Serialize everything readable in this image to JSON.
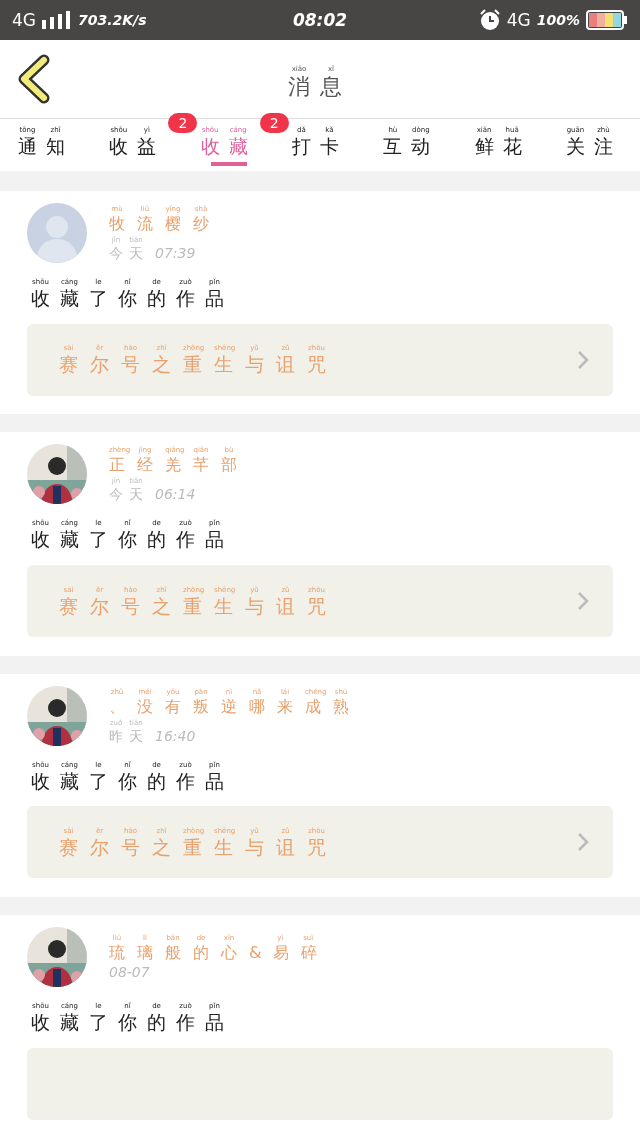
{
  "status_bar": {
    "network": "4G",
    "speed": "703.2K/s",
    "time": "08:02",
    "network_2": "4G",
    "battery": "100%"
  },
  "header": {
    "title": "消息",
    "title_pinyin": "xiāo xī"
  },
  "tabs": [
    {
      "label": "通知",
      "pinyin": "tōng zhī",
      "selected": false
    },
    {
      "label": "收益",
      "pinyin": "shōu yì",
      "selected": false,
      "badge": "2"
    },
    {
      "label": "收藏",
      "pinyin": "shōu cáng",
      "selected": true,
      "badge": "2"
    },
    {
      "label": "打卡",
      "pinyin": "dǎ kǎ",
      "selected": false
    },
    {
      "label": "互动",
      "pinyin": "hù dòng",
      "selected": false
    },
    {
      "label": "鲜花",
      "pinyin": "xiān huā",
      "selected": false
    },
    {
      "label": "关注",
      "pinyin": "guān zhù",
      "selected": false
    }
  ],
  "messages": [
    {
      "avatar": {
        "kind": "default"
      },
      "name": "牧流樱纱",
      "name_pinyin": "mù liú yīng shā",
      "day": "今天",
      "day_pinyin": "jīn tiān",
      "time": "07:39",
      "action": "收藏了你的作品",
      "action_pinyin": "shōu cáng le nǐ de zuò pǐn",
      "work": "赛尔号之重生与诅咒",
      "work_pinyin": "sài ěr hào zhī zhòng shēng yǔ zǔ zhòu"
    },
    {
      "name": "正经羌芊部",
      "name_pinyin": "zhèng jīng qiāng qiān bù",
      "day": "今天",
      "day_pinyin": "jīn tiān",
      "time": "06:14",
      "action": "收藏了你的作品",
      "action_pinyin": "shōu cáng le nǐ de zuò pǐn",
      "work": "赛尔号之重生与诅咒",
      "work_pinyin": "sài ěr hào zhī zhòng shēng yǔ zǔ zhòu"
    },
    {
      "name": "、没有叛逆哪来成熟",
      "name_pinyin": "zhǔ méi yǒu pàn nì nǎ lái chéng shú",
      "day": "昨天",
      "day_pinyin": "zuó tiān",
      "time": "16:40",
      "action": "收藏了你的作品",
      "action_pinyin": "shōu cáng le nǐ de zuò pǐn",
      "work": "赛尔号之重生与诅咒",
      "work_pinyin": "sài ěr hào zhī zhòng shēng yǔ zǔ zhòu"
    },
    {
      "name": "琉璃般的心&易碎",
      "name_pinyin": "liú lí bān de xīn yì suì",
      "time": "08-07",
      "action": "收藏了你的作品",
      "action_pinyin": "shōu cáng le nǐ de zuò pǐn"
    }
  ]
}
